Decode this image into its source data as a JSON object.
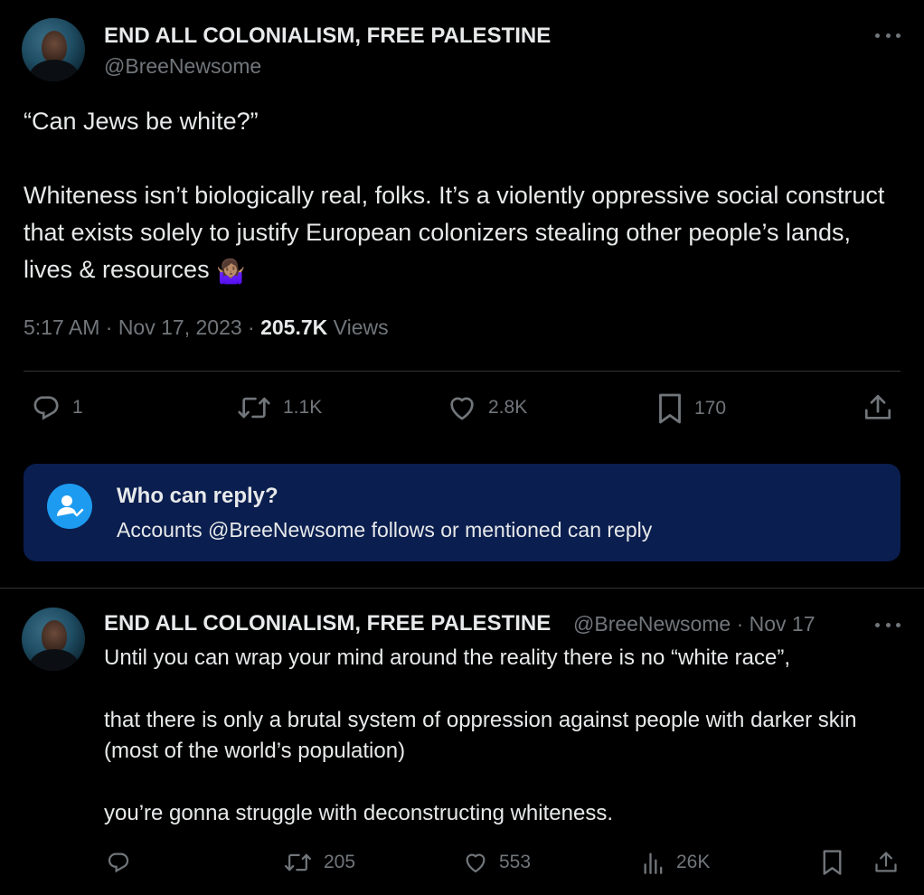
{
  "main_tweet": {
    "author_name": "END ALL COLONIALISM, FREE PALESTINE",
    "handle": "@BreeNewsome",
    "line1": "“Can Jews be white?”",
    "line2": "Whiteness isn’t biologically real, folks. It’s a violently oppressive social construct that exists solely to justify European colonizers stealing other people’s lands, lives & resources ",
    "emoji": "🤷🏽‍♀️",
    "time": "5:17 AM · Nov 17, 2023 · ",
    "views_count": "205.7K",
    "views_label": " Views",
    "stats": {
      "replies": "1",
      "reposts": "1.1K",
      "likes": "2.8K",
      "bookmarks": "170"
    }
  },
  "who_can_reply": {
    "title": "Who can reply?",
    "subtitle": "Accounts @BreeNewsome follows or mentioned can reply"
  },
  "reply_tweet": {
    "author_name": "END ALL COLONIALISM, FREE PALESTINE",
    "handle_date": "@BreeNewsome · Nov 17",
    "para1": "Until you can wrap your mind around the reality there is no “white race”,",
    "para2": "that there is only a brutal system of oppression against people with darker skin (most of the world’s population)",
    "para3": "you’re gonna struggle with deconstructing whiteness.",
    "stats": {
      "replies": "",
      "reposts": "205",
      "likes": "553",
      "views": "26K"
    }
  },
  "colors": {
    "background": "#000000",
    "text": "#e7e9ea",
    "muted": "#71767b",
    "accent": "#1d9bf0",
    "reply_box_bg": "#0a1e4f"
  }
}
